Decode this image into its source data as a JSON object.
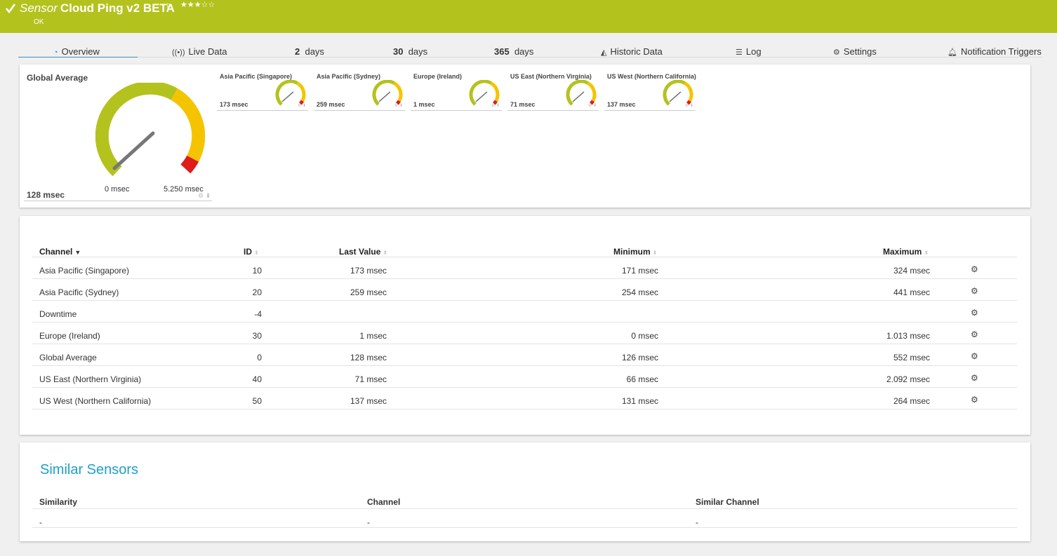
{
  "header": {
    "kind": "Sensor",
    "name": "Cloud Ping v2 BETA",
    "stars": "★★★☆☆",
    "status": "OK",
    "color": "#b4c21e"
  },
  "tabs": {
    "overview": "Overview",
    "live": "Live Data",
    "d2_num": "2",
    "d2_unit": "days",
    "d30_num": "30",
    "d30_unit": "days",
    "d365_num": "365",
    "d365_unit": "days",
    "historic": "Historic Data",
    "log": "Log",
    "settings": "Settings",
    "triggers": "Notification Triggers"
  },
  "gauges": {
    "main": {
      "label": "Global Average",
      "value": "128 msec",
      "min": "0 msec",
      "max": "5.250 msec"
    },
    "mini": [
      {
        "label": "Asia Pacific (Singapore)",
        "value": "173 msec"
      },
      {
        "label": "Asia Pacific (Sydney)",
        "value": "259 msec"
      },
      {
        "label": "Europe (Ireland)",
        "value": "1 msec"
      },
      {
        "label": "US East (Northern Virginia)",
        "value": "71 msec"
      },
      {
        "label": "US West (Northern California)",
        "value": "137 msec"
      }
    ]
  },
  "channels": {
    "headers": {
      "channel": "Channel",
      "id": "ID",
      "last": "Last Value",
      "min": "Minimum",
      "max": "Maximum"
    },
    "rows": [
      {
        "name": "Asia Pacific (Singapore)",
        "id": "10",
        "last": "173 msec",
        "min": "171 msec",
        "max": "324 msec"
      },
      {
        "name": "Asia Pacific (Sydney)",
        "id": "20",
        "last": "259 msec",
        "min": "254 msec",
        "max": "441 msec"
      },
      {
        "name": "Downtime",
        "id": "-4",
        "last": "",
        "min": "",
        "max": ""
      },
      {
        "name": "Europe (Ireland)",
        "id": "30",
        "last": "1 msec",
        "min": "0 msec",
        "max": "1.013 msec"
      },
      {
        "name": "Global Average",
        "id": "0",
        "last": "128 msec",
        "min": "126 msec",
        "max": "552 msec"
      },
      {
        "name": "US East (Northern Virginia)",
        "id": "40",
        "last": "71 msec",
        "min": "66 msec",
        "max": "2.092 msec"
      },
      {
        "name": "US West (Northern California)",
        "id": "50",
        "last": "137 msec",
        "min": "131 msec",
        "max": "264 msec"
      }
    ]
  },
  "similar": {
    "title": "Similar Sensors",
    "headers": {
      "similarity": "Similarity",
      "channel": "Channel",
      "similar_channel": "Similar Channel"
    },
    "row": {
      "similarity": "-",
      "channel": "-",
      "similar_channel": "-"
    }
  },
  "colors": {
    "gauge_green": "#b4c21e",
    "gauge_yellow": "#f5c400",
    "gauge_red": "#e01b1b",
    "accent_blue": "#1ea0c8"
  }
}
